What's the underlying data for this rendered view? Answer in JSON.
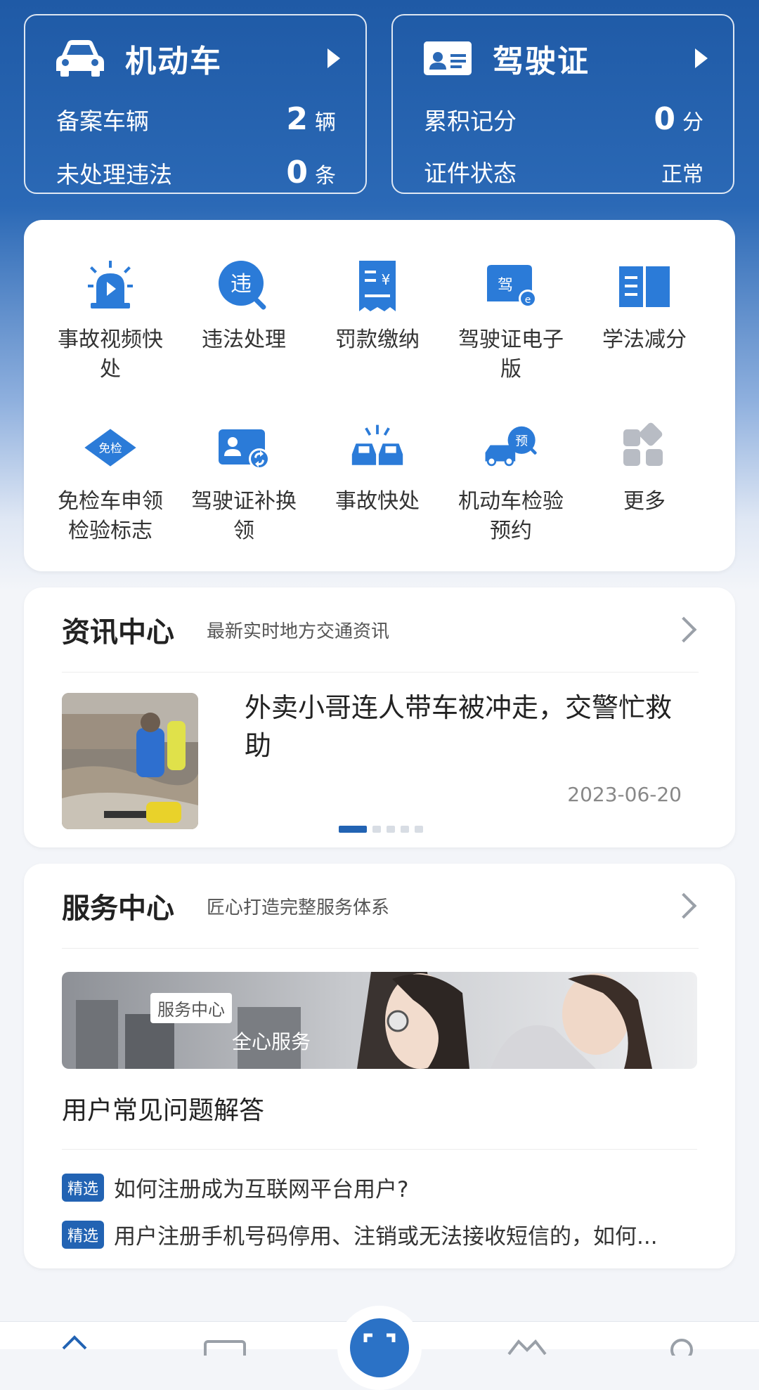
{
  "vehicle_card": {
    "title": "机动车",
    "row1_label": "备案车辆",
    "row1_value": "2",
    "row1_unit": "辆",
    "row2_label": "未处理违法",
    "row2_value": "0",
    "row2_unit": "条"
  },
  "license_card": {
    "title": "驾驶证",
    "row1_label": "累积记分",
    "row1_value": "0",
    "row1_unit": "分",
    "row2_label": "证件状态",
    "row2_value": "正常"
  },
  "quick_services": [
    {
      "label": "事故视频快处",
      "icon": "alarm-light-icon"
    },
    {
      "label": "违法处理",
      "icon": "violation-search-icon"
    },
    {
      "label": "罚款缴纳",
      "icon": "fine-receipt-icon"
    },
    {
      "label": "驾驶证电子版",
      "icon": "e-license-icon"
    },
    {
      "label": "学法减分",
      "icon": "book-icon"
    },
    {
      "label": "免检车申领检验标志",
      "icon": "exempt-badge-icon"
    },
    {
      "label": "驾驶证补换领",
      "icon": "license-renew-icon"
    },
    {
      "label": "事故快处",
      "icon": "car-crash-icon"
    },
    {
      "label": "机动车检验预约",
      "icon": "vehicle-appointment-icon"
    },
    {
      "label": "更多",
      "icon": "more-grid-icon"
    }
  ],
  "news": {
    "title": "资讯中心",
    "subtitle": "最新实时地方交通资讯",
    "headline": "外卖小哥连人带车被冲走，交警忙救助",
    "date": "2023-06-20"
  },
  "service": {
    "title": "服务中心",
    "subtitle": "匠心打造完整服务体系",
    "banner_tag": "服务中心",
    "banner_text": "全心服务",
    "faq_title": "用户常见问题解答",
    "tag": "精选",
    "questions": [
      "如何注册成为互联网平台用户?",
      "用户注册手机号码停用、注销或无法接收短信的，如何..."
    ]
  },
  "colors": {
    "primary": "#2263b3",
    "icon_blue": "#2b7bd8",
    "icon_grey": "#b8bcc4"
  }
}
